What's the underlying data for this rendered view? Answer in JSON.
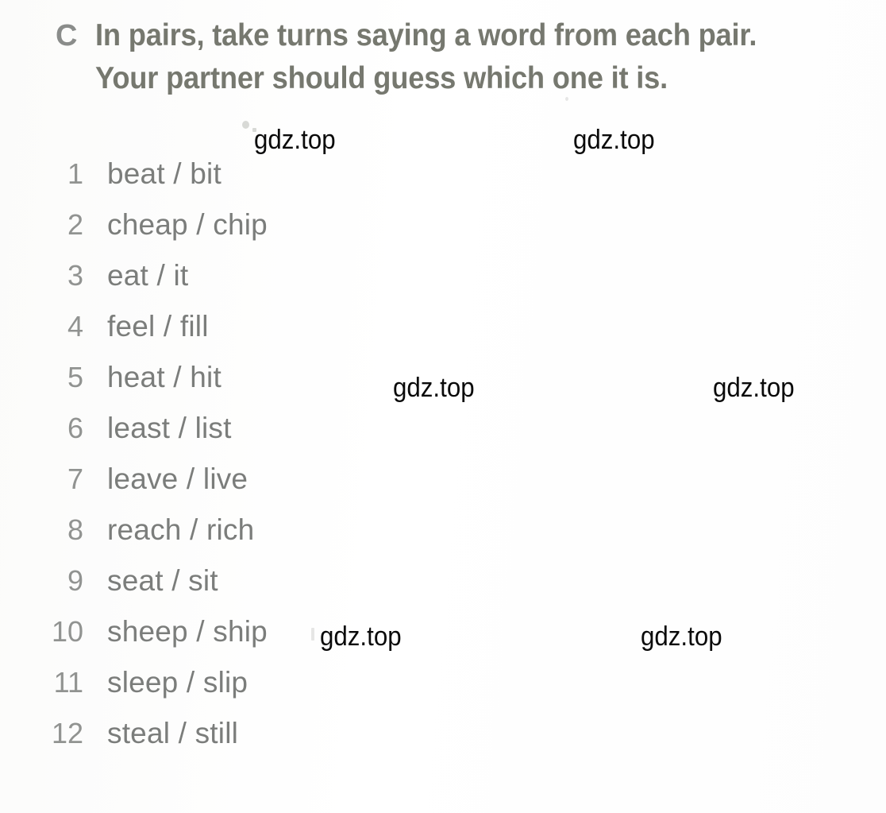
{
  "exercise": {
    "letter": "C",
    "instruction": "In pairs, take turns saying a word from each pair. Your partner should guess which one it is."
  },
  "pairs": [
    {
      "number": "1",
      "words": "beat / bit"
    },
    {
      "number": "2",
      "words": "cheap / chip"
    },
    {
      "number": "3",
      "words": "eat / it"
    },
    {
      "number": "4",
      "words": "feel / fill"
    },
    {
      "number": "5",
      "words": "heat / hit"
    },
    {
      "number": "6",
      "words": "least / list"
    },
    {
      "number": "7",
      "words": "leave / live"
    },
    {
      "number": "8",
      "words": "reach / rich"
    },
    {
      "number": "9",
      "words": "seat / sit"
    },
    {
      "number": "10",
      "words": "sheep / ship"
    },
    {
      "number": "11",
      "words": "sleep / slip"
    },
    {
      "number": "12",
      "words": "steal / still"
    }
  ],
  "watermarks": [
    {
      "text": "gdz.top"
    },
    {
      "text": "gdz.top"
    },
    {
      "text": "gdz.top"
    },
    {
      "text": "gdz.top"
    },
    {
      "text": "gdz.top"
    },
    {
      "text": "gdz.top"
    }
  ],
  "colors": {
    "page_background": "#fdfdfc",
    "heading_text": "#76786f",
    "letter_text": "#8a8c8a",
    "number_text": "#919391",
    "word_text": "#7b7d7b",
    "watermark_text": "#0a0a0a"
  }
}
